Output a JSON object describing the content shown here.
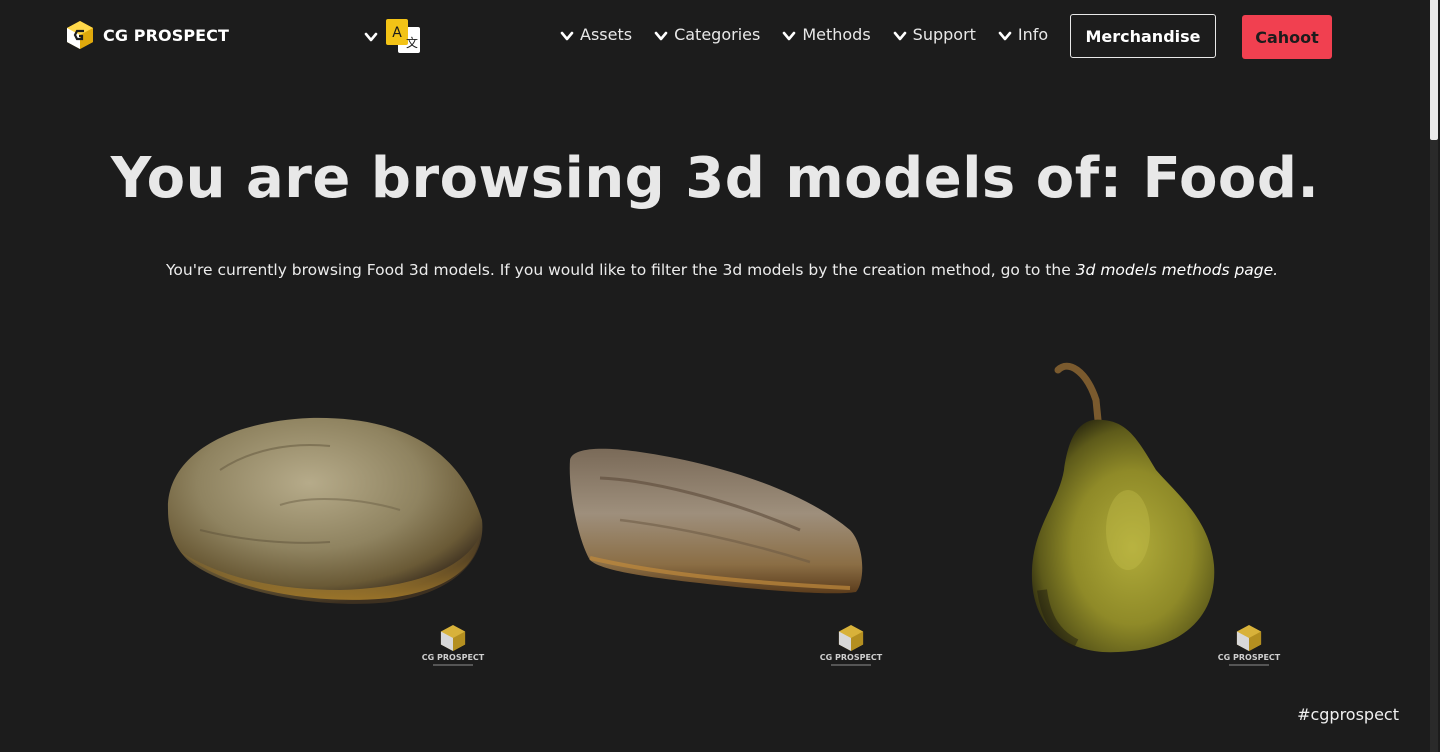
{
  "brand": {
    "name": "CG PROSPECT"
  },
  "nav": {
    "language_icon": "translate-icon",
    "items": [
      {
        "label": "Assets"
      },
      {
        "label": "Categories"
      },
      {
        "label": "Methods"
      },
      {
        "label": "Support"
      },
      {
        "label": "Info"
      }
    ],
    "merch_label": "Merchandise",
    "cahoot_label": "Cahoot"
  },
  "colors": {
    "background": "#1c1c1c",
    "cahoot": "#f14050",
    "logo_yellow": "#f3c316"
  },
  "page": {
    "title": "You are browsing 3d models of: Food.",
    "intro": "You're currently browsing Food 3d models. If you would like to filter the 3d models by the creation method, go to the ",
    "methods_link": "3d models methods page."
  },
  "models": [
    {
      "name": "bread-loaf",
      "watermark": "CG PROSPECT"
    },
    {
      "name": "ciabatta-bread",
      "watermark": "CG PROSPECT"
    },
    {
      "name": "pear",
      "watermark": "CG PROSPECT"
    }
  ],
  "footer": {
    "hashtag": "#cgprospect"
  }
}
